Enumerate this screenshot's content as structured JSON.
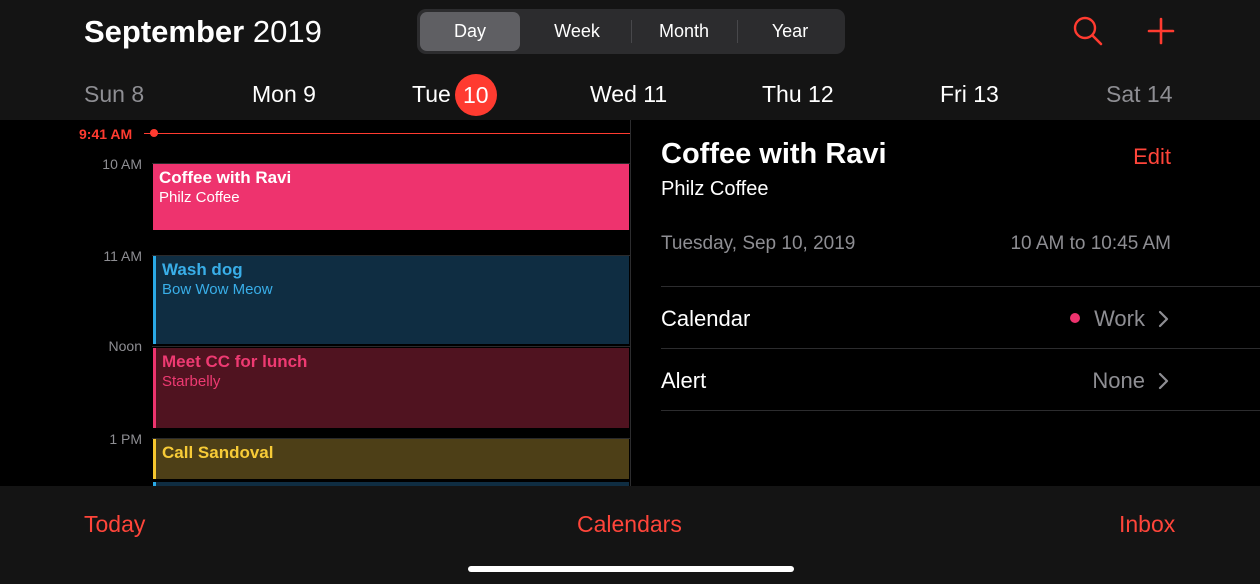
{
  "header": {
    "month": "September",
    "year": "2019",
    "segments": [
      "Day",
      "Week",
      "Month",
      "Year"
    ],
    "active_segment": "Day",
    "search_icon": "search-icon",
    "add_icon": "plus-icon",
    "accent_color": "#ff3b30"
  },
  "week": {
    "days": [
      {
        "label": "Sun 8"
      },
      {
        "label": "Mon 9"
      },
      {
        "label": "Tue",
        "number": "10"
      },
      {
        "label": "Wed 11"
      },
      {
        "label": "Thu 12"
      },
      {
        "label": "Fri 13"
      },
      {
        "label": "Sat 14"
      }
    ],
    "selected": "Tue 10"
  },
  "timeline": {
    "now_label": "9:41 AM",
    "hours": [
      "10 AM",
      "11 AM",
      "Noon",
      "1 PM"
    ],
    "events": [
      {
        "title": "Coffee with Ravi",
        "location": "Philz Coffee",
        "color": "#ee336e"
      },
      {
        "title": "Wash dog",
        "location": "Bow Wow Meow",
        "color": "#39aee8"
      },
      {
        "title": "Meet CC for lunch",
        "location": "Starbelly",
        "color": "#ee3a72"
      },
      {
        "title": "Call Sandoval",
        "location": "",
        "color": "#f7cb37"
      }
    ]
  },
  "detail": {
    "title": "Coffee with Ravi",
    "edit_label": "Edit",
    "location": "Philz Coffee",
    "date": "Tuesday, Sep 10, 2019",
    "time": "10 AM to 10:45 AM",
    "calendar_label": "Calendar",
    "calendar_value": "Work",
    "calendar_color": "#ee336e",
    "alert_label": "Alert",
    "alert_value": "None"
  },
  "toolbar": {
    "today": "Today",
    "calendars": "Calendars",
    "inbox": "Inbox"
  }
}
